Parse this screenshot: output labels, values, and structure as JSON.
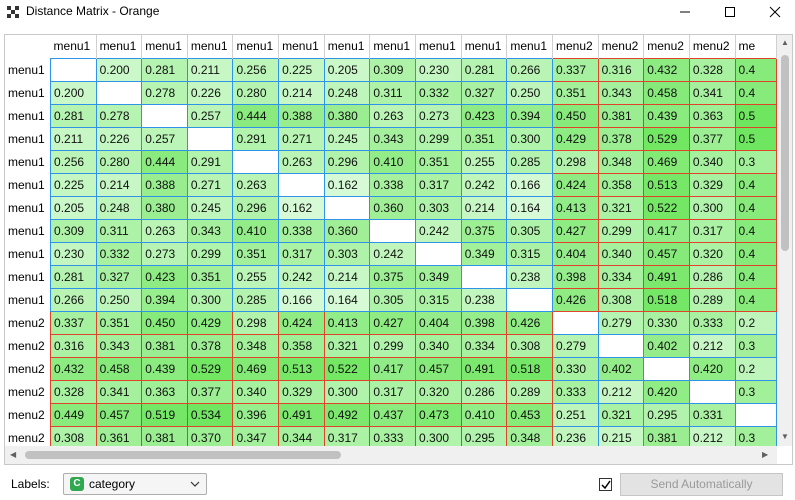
{
  "window": {
    "title": "Distance Matrix - Orange",
    "icon": "orange-matrix-icon"
  },
  "matrix": {
    "col_labels": [
      "menu1",
      "menu1",
      "menu1",
      "menu1",
      "menu1",
      "menu1",
      "menu1",
      "menu1",
      "menu1",
      "menu1",
      "menu1",
      "menu2",
      "menu2",
      "menu2",
      "menu2",
      "me"
    ],
    "row_labels": [
      "menu1",
      "menu1",
      "menu1",
      "menu1",
      "menu1",
      "menu1",
      "menu1",
      "menu1",
      "menu1",
      "menu1",
      "menu1",
      "menu2",
      "menu2",
      "menu2",
      "menu2",
      "menu2",
      "menu2"
    ],
    "diag_index": [
      0,
      1,
      2,
      3,
      4,
      5,
      6,
      7,
      8,
      9,
      10,
      11,
      12,
      13,
      14,
      15,
      null
    ],
    "cells": [
      [
        "",
        "0.200",
        "0.281",
        "0.211",
        "0.256",
        "0.225",
        "0.205",
        "0.309",
        "0.230",
        "0.281",
        "0.266",
        "0.337",
        "0.316",
        "0.432",
        "0.328",
        "0.4"
      ],
      [
        "0.200",
        "",
        "0.278",
        "0.226",
        "0.280",
        "0.214",
        "0.248",
        "0.311",
        "0.332",
        "0.327",
        "0.250",
        "0.351",
        "0.343",
        "0.458",
        "0.341",
        "0.4"
      ],
      [
        "0.281",
        "0.278",
        "",
        "0.257",
        "0.444",
        "0.388",
        "0.380",
        "0.263",
        "0.273",
        "0.423",
        "0.394",
        "0.450",
        "0.381",
        "0.439",
        "0.363",
        "0.5"
      ],
      [
        "0.211",
        "0.226",
        "0.257",
        "",
        "0.291",
        "0.271",
        "0.245",
        "0.343",
        "0.299",
        "0.351",
        "0.300",
        "0.429",
        "0.378",
        "0.529",
        "0.377",
        "0.5"
      ],
      [
        "0.256",
        "0.280",
        "0.444",
        "0.291",
        "",
        "0.263",
        "0.296",
        "0.410",
        "0.351",
        "0.255",
        "0.285",
        "0.298",
        "0.348",
        "0.469",
        "0.340",
        "0.3"
      ],
      [
        "0.225",
        "0.214",
        "0.388",
        "0.271",
        "0.263",
        "",
        "0.162",
        "0.338",
        "0.317",
        "0.242",
        "0.166",
        "0.424",
        "0.358",
        "0.513",
        "0.329",
        "0.4"
      ],
      [
        "0.205",
        "0.248",
        "0.380",
        "0.245",
        "0.296",
        "0.162",
        "",
        "0.360",
        "0.303",
        "0.214",
        "0.164",
        "0.413",
        "0.321",
        "0.522",
        "0.300",
        "0.4"
      ],
      [
        "0.309",
        "0.311",
        "0.263",
        "0.343",
        "0.410",
        "0.338",
        "0.360",
        "",
        "0.242",
        "0.375",
        "0.305",
        "0.427",
        "0.299",
        "0.417",
        "0.317",
        "0.4"
      ],
      [
        "0.230",
        "0.332",
        "0.273",
        "0.299",
        "0.351",
        "0.317",
        "0.303",
        "0.242",
        "",
        "0.349",
        "0.315",
        "0.404",
        "0.340",
        "0.457",
        "0.320",
        "0.4"
      ],
      [
        "0.281",
        "0.327",
        "0.423",
        "0.351",
        "0.255",
        "0.242",
        "0.214",
        "0.375",
        "0.349",
        "",
        "0.238",
        "0.398",
        "0.334",
        "0.491",
        "0.286",
        "0.4"
      ],
      [
        "0.266",
        "0.250",
        "0.394",
        "0.300",
        "0.285",
        "0.166",
        "0.164",
        "0.305",
        "0.315",
        "0.238",
        "",
        "0.426",
        "0.308",
        "0.518",
        "0.289",
        "0.4"
      ],
      [
        "0.337",
        "0.351",
        "0.450",
        "0.429",
        "0.298",
        "0.424",
        "0.413",
        "0.427",
        "0.404",
        "0.398",
        "0.426",
        "",
        "0.279",
        "0.330",
        "0.333",
        "0.2"
      ],
      [
        "0.316",
        "0.343",
        "0.381",
        "0.378",
        "0.348",
        "0.358",
        "0.321",
        "0.299",
        "0.340",
        "0.334",
        "0.308",
        "0.279",
        "",
        "0.402",
        "0.212",
        "0.3"
      ],
      [
        "0.432",
        "0.458",
        "0.439",
        "0.529",
        "0.469",
        "0.513",
        "0.522",
        "0.417",
        "0.457",
        "0.491",
        "0.518",
        "0.330",
        "0.402",
        "",
        "0.420",
        "0.2"
      ],
      [
        "0.328",
        "0.341",
        "0.363",
        "0.377",
        "0.340",
        "0.329",
        "0.300",
        "0.317",
        "0.320",
        "0.286",
        "0.289",
        "0.333",
        "0.212",
        "0.420",
        "",
        "0.3"
      ],
      [
        "0.449",
        "0.457",
        "0.519",
        "0.534",
        "0.396",
        "0.491",
        "0.492",
        "0.437",
        "0.473",
        "0.410",
        "0.453",
        "0.251",
        "0.321",
        "0.295",
        "0.331",
        ""
      ],
      [
        "0.308",
        "0.361",
        "0.381",
        "0.370",
        "0.347",
        "0.344",
        "0.317",
        "0.333",
        "0.300",
        "0.295",
        "0.348",
        "0.236",
        "0.215",
        "0.381",
        "0.212",
        "0.3"
      ]
    ],
    "colors": {
      "low": "#d6fad6",
      "high": "#6fe65f",
      "grid_same": "#2f93e8",
      "grid_cross": "#e0432a"
    }
  },
  "bottom": {
    "labels_caption": "Labels:",
    "labels_value": "category",
    "labels_badge": "C",
    "send_automatically_checked": true,
    "send_button": "Send Automatically"
  }
}
